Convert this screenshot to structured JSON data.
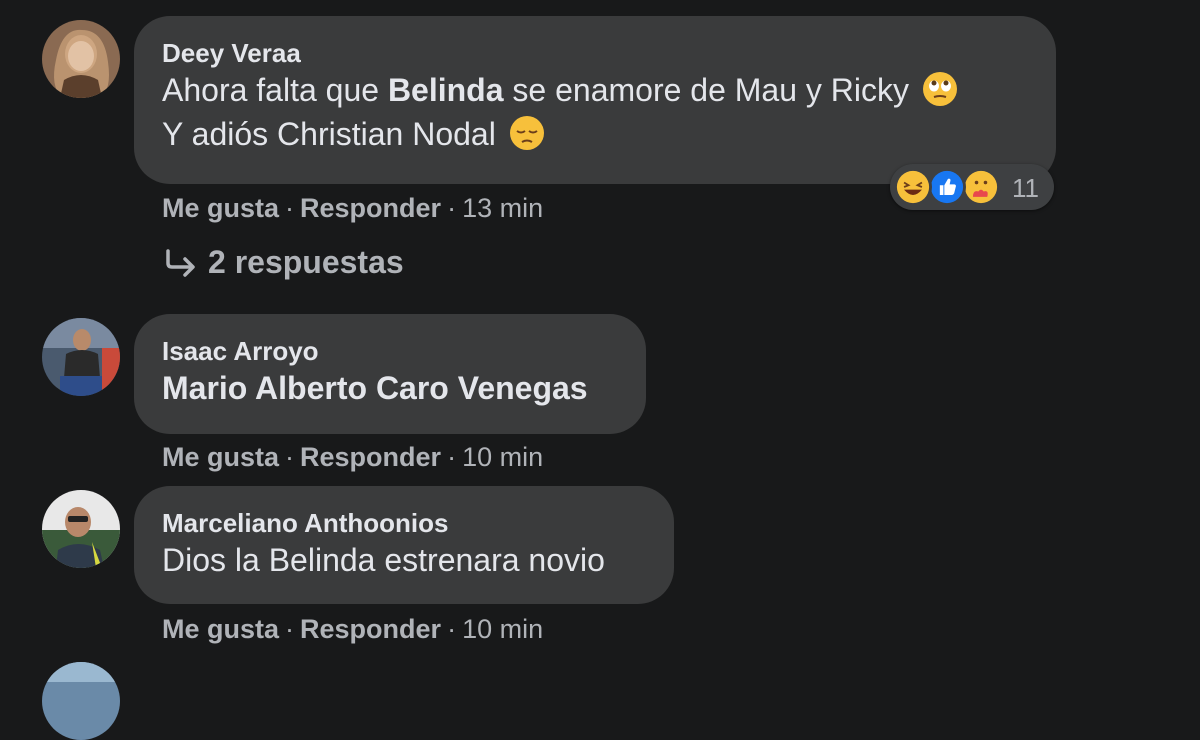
{
  "comments": [
    {
      "author": "Deey Veraa",
      "text_part1": "Ahora falta que ",
      "text_bold": "Belinda",
      "text_part2": " se enamore de Mau y Ricky",
      "text_line2": "Y adiós Christian Nodal",
      "like_label": "Me gusta",
      "reply_label": "Responder",
      "time": "13 min",
      "reactions_count": "11",
      "reactions": [
        "laughing-emoji",
        "like-icon",
        "care-emoji"
      ],
      "replies_label": "2 respuestas"
    },
    {
      "author": "Isaac Arroyo",
      "text": "Mario Alberto Caro Venegas",
      "like_label": "Me gusta",
      "reply_label": "Responder",
      "time": "10 min"
    },
    {
      "author": "Marceliano Anthoonios",
      "text": "Dios la Belinda estrenara novio",
      "like_label": "Me gusta",
      "reply_label": "Responder",
      "time": "10 min"
    }
  ],
  "separator": "·",
  "colors": {
    "background": "#18191a",
    "bubble": "#3a3b3c",
    "text": "#e4e6eb",
    "secondary": "#b0b3b8",
    "like_blue": "#1877f2"
  }
}
